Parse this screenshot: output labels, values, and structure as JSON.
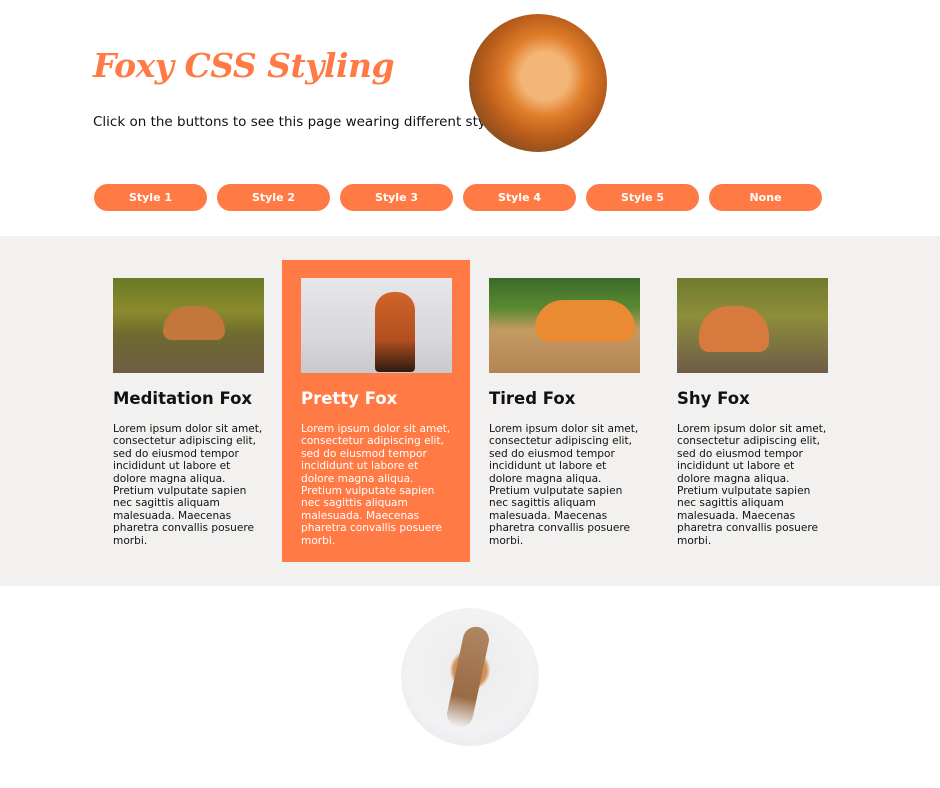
{
  "header": {
    "title": "Foxy CSS Styling",
    "subtitle": "Click on the buttons to see this page wearing different styles."
  },
  "buttons": [
    "Style 1",
    "Style 2",
    "Style 3",
    "Style 4",
    "Style 5",
    "None"
  ],
  "cards": [
    {
      "title": "Meditation Fox",
      "text": "Lorem ipsum dolor sit amet, consectetur adipiscing elit, sed do eiusmod tempor incididunt ut labore et dolore magna aliqua. Pretium vulputate sapien nec sagittis aliquam malesuada. Maecenas pharetra convallis posuere morbi."
    },
    {
      "title": "Pretty Fox",
      "text": "Lorem ipsum dolor sit amet, consectetur adipiscing elit, sed do eiusmod tempor incididunt ut labore et dolore magna aliqua. Pretium vulputate sapien nec sagittis aliquam malesuada. Maecenas pharetra convallis posuere morbi."
    },
    {
      "title": "Tired Fox",
      "text": "Lorem ipsum dolor sit amet, consectetur adipiscing elit, sed do eiusmod tempor incididunt ut labore et dolore magna aliqua. Pretium vulputate sapien nec sagittis aliquam malesuada. Maecenas pharetra convallis posuere morbi."
    },
    {
      "title": "Shy Fox",
      "text": "Lorem ipsum dolor sit amet, consectetur adipiscing elit, sed do eiusmod tempor incididunt ut labore et dolore magna aliqua. Pretium vulputate sapien nec sagittis aliquam malesuada. Maecenas pharetra convallis posuere morbi."
    }
  ],
  "colors": {
    "accent": "#ff7a45",
    "band_background": "#f2f1f0",
    "text": "#111111",
    "button_text": "#ffffff"
  }
}
